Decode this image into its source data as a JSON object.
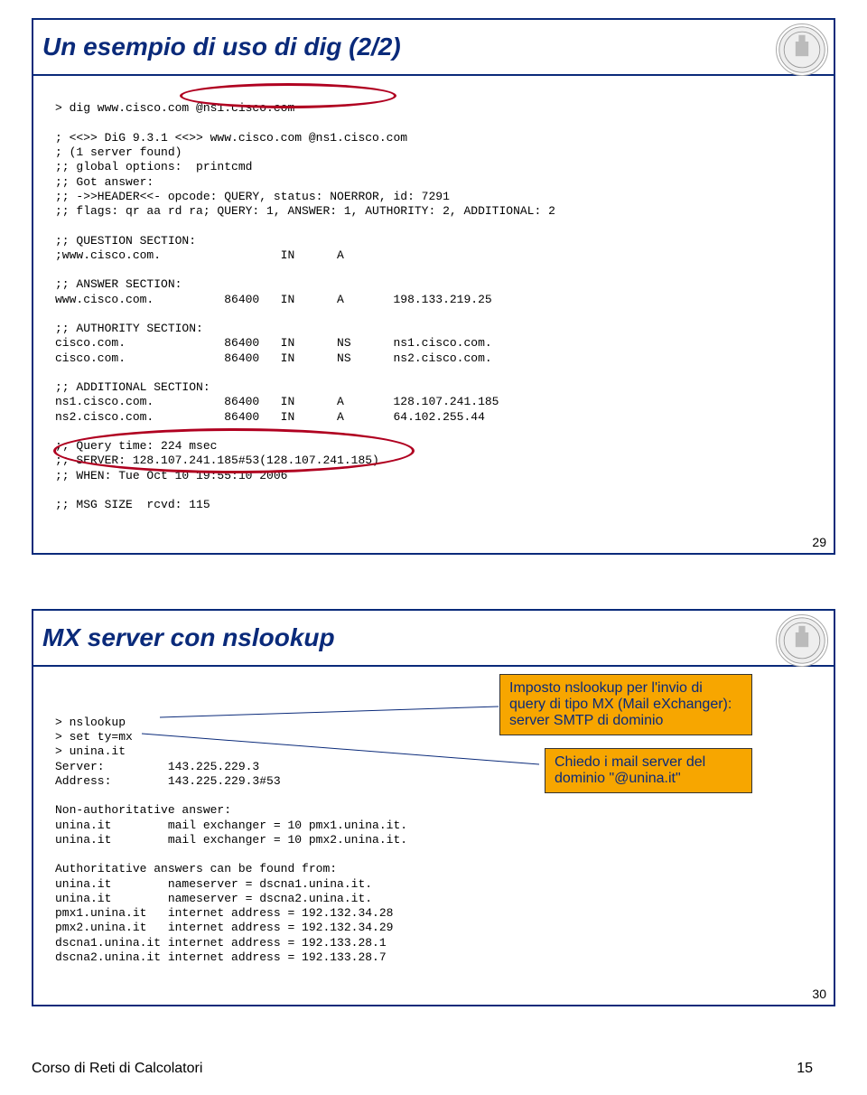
{
  "slide1": {
    "title": "Un esempio di uso di dig (2/2)",
    "line1": "> dig www.cisco.com @ns1.cisco.com",
    "line2": "; <<>> DiG 9.3.1 <<>> www.cisco.com @ns1.cisco.com",
    "line3": "; (1 server found)",
    "line4": ";; global options:  printcmd",
    "line5": ";; Got answer:",
    "line6": ";; ->>HEADER<<- opcode: QUERY, status: NOERROR, id: 7291",
    "line7": ";; flags: qr aa rd ra; QUERY: 1, ANSWER: 1, AUTHORITY: 2, ADDITIONAL: 2",
    "line8": ";; QUESTION SECTION:",
    "line9": ";www.cisco.com.                 IN      A",
    "line10": ";; ANSWER SECTION:",
    "line11": "www.cisco.com.          86400   IN      A       198.133.219.25",
    "line12": ";; AUTHORITY SECTION:",
    "line13": "cisco.com.              86400   IN      NS      ns1.cisco.com.",
    "line14": "cisco.com.              86400   IN      NS      ns2.cisco.com.",
    "line15": ";; ADDITIONAL SECTION:",
    "line16": "ns1.cisco.com.          86400   IN      A       128.107.241.185",
    "line17": "ns2.cisco.com.          86400   IN      A       64.102.255.44",
    "line18": ";; Query time: 224 msec",
    "line19": ";; SERVER: 128.107.241.185#53(128.107.241.185)",
    "line20": ";; WHEN: Tue Oct 10 19:55:10 2006",
    "line21": ";; MSG SIZE  rcvd: 115",
    "pagenum": "29"
  },
  "slide2": {
    "title": "MX server con nslookup",
    "line1": "> nslookup",
    "line2": "> set ty=mx",
    "line3": "> unina.it",
    "line4": "Server:         143.225.229.3",
    "line5": "Address:        143.225.229.3#53",
    "line6": "Non-authoritative answer:",
    "line7": "unina.it        mail exchanger = 10 pmx1.unina.it.",
    "line8": "unina.it        mail exchanger = 10 pmx2.unina.it.",
    "line9": "Authoritative answers can be found from:",
    "line10": "unina.it        nameserver = dscna1.unina.it.",
    "line11": "unina.it        nameserver = dscna2.unina.it.",
    "line12": "pmx1.unina.it   internet address = 192.132.34.28",
    "line13": "pmx2.unina.it   internet address = 192.132.34.29",
    "line14": "dscna1.unina.it internet address = 192.133.28.1",
    "line15": "dscna2.unina.it internet address = 192.133.28.7",
    "note1a": "Imposto nslookup per l'invio di",
    "note1b": "query di tipo MX (Mail eXchanger):",
    "note1c": "server SMTP di dominio",
    "note2a": "Chiedo i mail server del",
    "note2b": "dominio \"@unina.it\"",
    "pagenum": "30"
  },
  "footer": {
    "left": "Corso di Reti di Calcolatori",
    "right": "15"
  }
}
